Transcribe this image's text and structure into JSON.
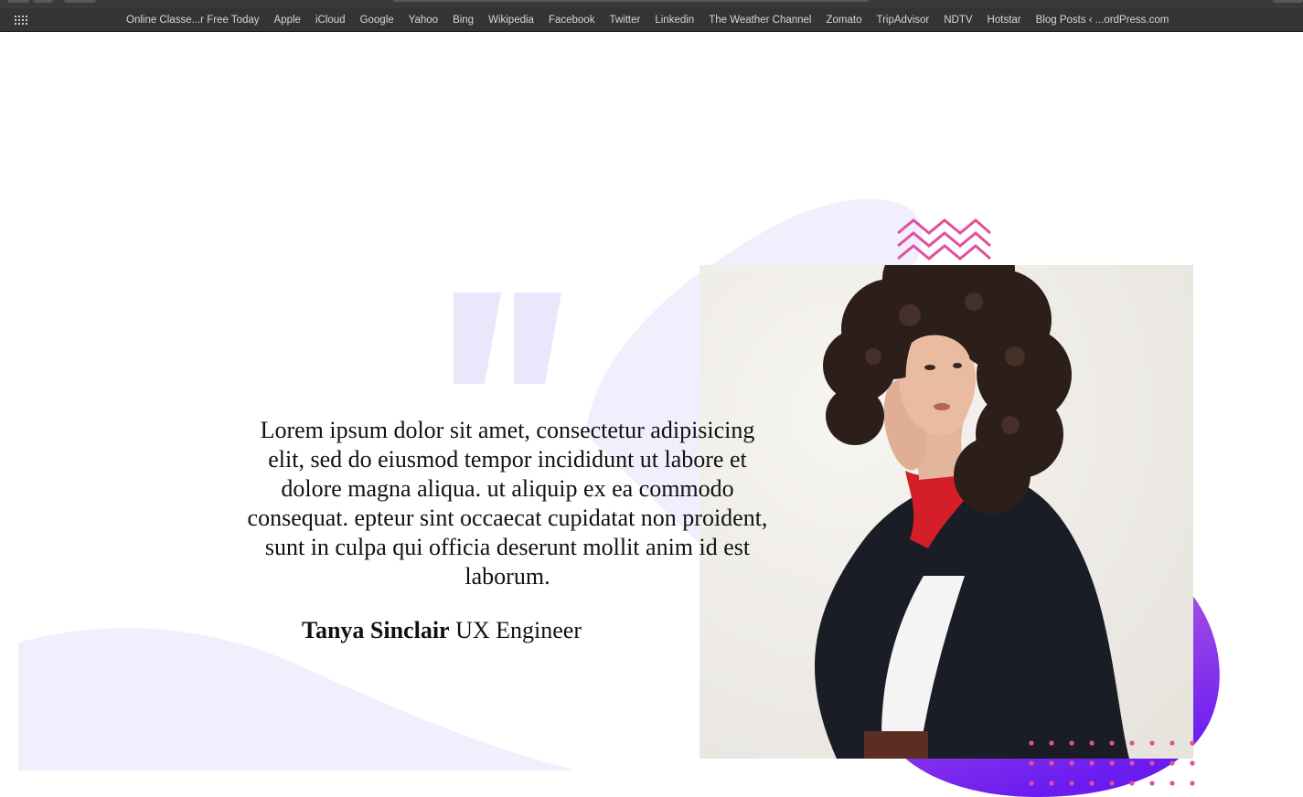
{
  "bookmarks_bar": {
    "apps_icon": "apps-grid-icon",
    "items": [
      "Online Classe...r Free Today",
      "Apple",
      "iCloud",
      "Google",
      "Yahoo",
      "Bing",
      "Wikipedia",
      "Facebook",
      "Twitter",
      "Linkedin",
      "The Weather Channel",
      "Zomato",
      "TripAdvisor",
      "NDTV",
      "Hotstar",
      "Blog Posts ‹ ...ordPress.com"
    ]
  },
  "testimonial": {
    "quote": "Lorem ipsum dolor sit amet, consectetur adipisicing elit, sed do eiusmod tempor incididunt ut labore et dolore magna aliqua. ut aliquip ex ea commodo consequat. epteur sint occaecat cupidatat non proident, sunt in culpa qui officia deserunt mollit anim id est laborum.",
    "author_name": "Tanya Sinclair",
    "author_role": "UX Engineer"
  },
  "colors": {
    "blob_light": "#f1effd",
    "quote_mark": "#ebe6fb",
    "accent_pink": "#e0509e",
    "gradient_start": "#c267e0",
    "gradient_end": "#6a1cf0",
    "chrome_bg": "#343434"
  }
}
